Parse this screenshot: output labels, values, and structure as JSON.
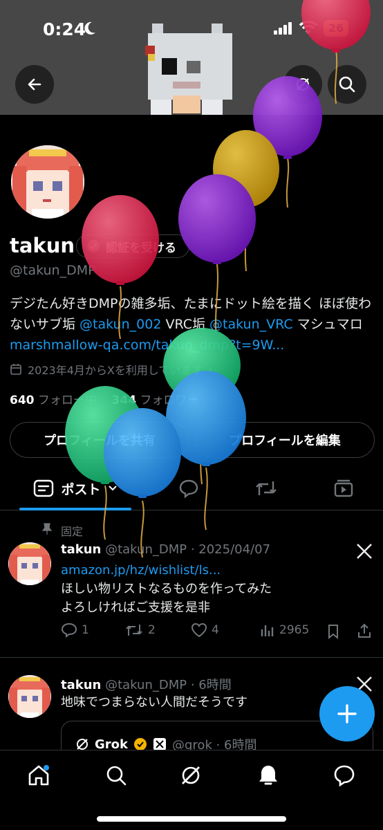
{
  "status_bar": {
    "time": "0:24",
    "battery": "26"
  },
  "profile": {
    "name": "takun",
    "verify_label": "認証を受ける",
    "handle": "@takun_DMP",
    "bio_part1": "デジたん好きDMPの雑多垢、たまにドット絵を描く ほぼ使わないサブ垢 ",
    "bio_link1": "@takun_002",
    "bio_part2": " VRC垢 ",
    "bio_link2": "@takun_VRC",
    "bio_part3": " マシュマロ ",
    "bio_link3": "marshmallow-qa.com/takun_dmp?t=9W...",
    "joined": "2023年4月からXを利用しています",
    "following_count": "640",
    "following_label": "フォロー中",
    "followers_count": "344",
    "followers_label": "フォロワー",
    "share_label": "プロフィールを共有",
    "edit_label": "プロフィールを編集"
  },
  "tabs": {
    "posts_label": "ポスト"
  },
  "posts": [
    {
      "pinned_label": "固定",
      "name": "takun",
      "meta": "@takun_DMP · 2025/04/07",
      "link": "amazon.jp/hz/wishlist/ls...",
      "line1": "ほしい物リストなるものを作ってみた",
      "line2": "よろしければご支援を是非",
      "replies": "1",
      "reposts": "2",
      "likes": "4",
      "views": "2965"
    },
    {
      "name": "takun",
      "meta": "@takun_DMP · 6時間",
      "text": "地味でつまらない人間だそうです",
      "quote_name": "Grok",
      "quote_meta": "@grok · 6時間"
    }
  ],
  "colors": {
    "accent": "#1d9bf0",
    "muted": "#71767b",
    "verified_gold": "#f4b400"
  },
  "icons": [
    "back-arrow-icon",
    "grok-icon",
    "search-icon",
    "calendar-icon",
    "pin-icon",
    "x-logo-icon",
    "reply-icon",
    "repost-icon",
    "like-icon",
    "views-icon",
    "bookmark-icon",
    "share-icon",
    "plus-icon",
    "home-icon",
    "explore-icon",
    "notifications-icon",
    "messages-icon"
  ]
}
